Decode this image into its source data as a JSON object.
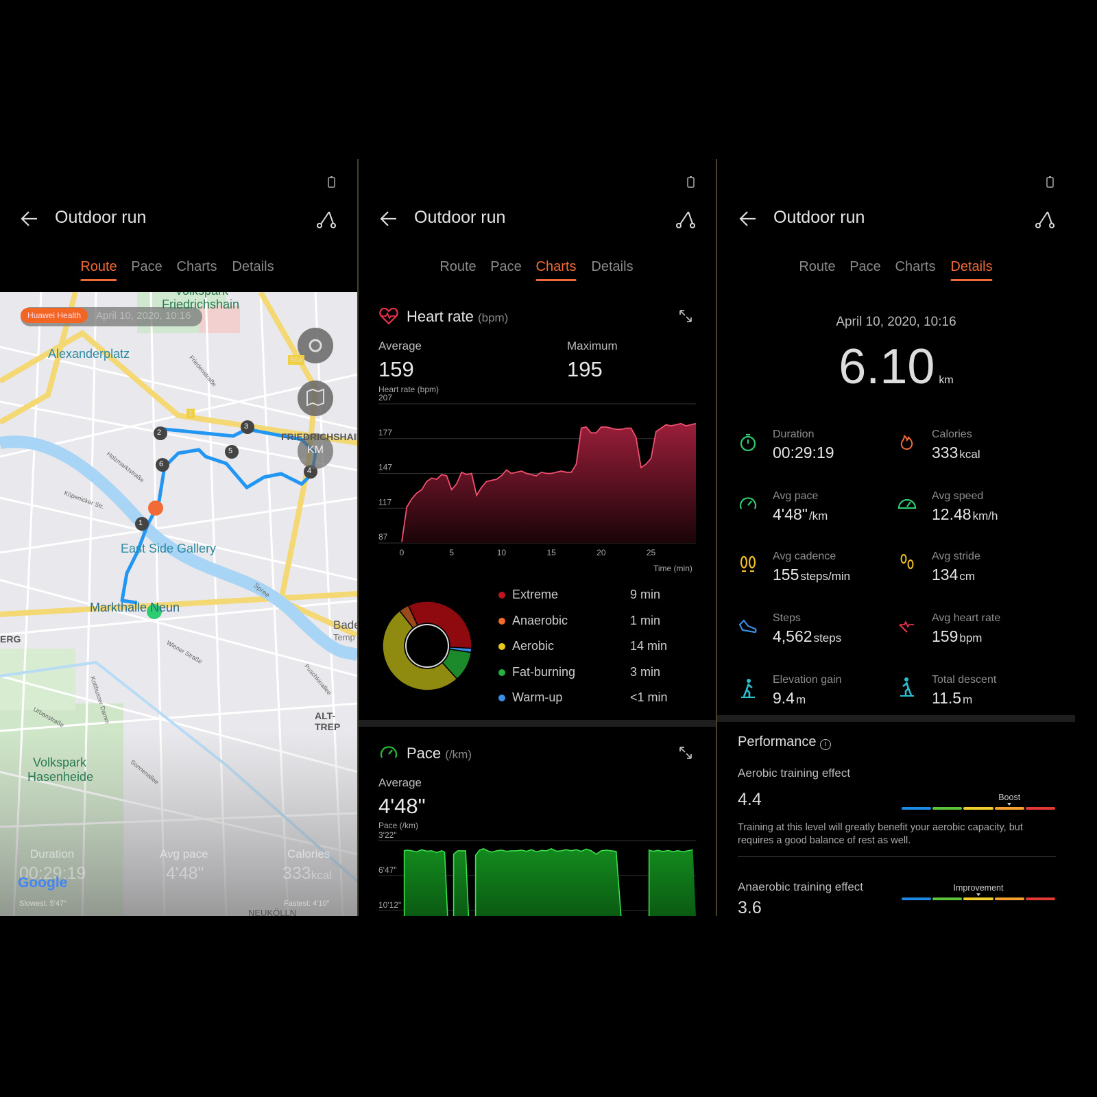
{
  "app_title": "Outdoor run",
  "tabs": [
    "Route",
    "Pace",
    "Charts",
    "Details"
  ],
  "active_tabs": {
    "panel1": "Route",
    "panel2": "Charts",
    "panel3": "Details"
  },
  "colors": {
    "accent": "#f26b36",
    "heart": "#e8334a",
    "pace": "#26c13a",
    "route": "#2196f3"
  },
  "map": {
    "badge": "Huawei Health",
    "date": "April 10, 2020, 10:16",
    "labels": {
      "park1_a": "Volkspark",
      "park1_b": "Friedrichshain",
      "alex": "Alexanderplatz",
      "friedrichshain": "FRIEDRICHSHAIN",
      "gallery": "East Side Gallery",
      "markthalle": "Markthalle Neun",
      "bade": "Bade",
      "temp": "Temp",
      "erg": "ERG",
      "alt": "ALT-TREP",
      "park2_a": "Volkspark",
      "park2_b": "Hasenheide",
      "neukoelln": "NEUKÖLLN",
      "road96": "96a",
      "road1": "1",
      "km": "KM",
      "spree": "Spree",
      "holz": "Holzmarktstraße",
      "kopen": "Köpenicker Str.",
      "wiener": "Wiener Straße",
      "kott": "Kottbusser Damm",
      "urban": "Urbanstraße",
      "sonnen": "Sonnenallee",
      "puschkin": "Puschkinallee",
      "friedenstr": "Friedenstraße"
    },
    "markers": [
      "1",
      "2",
      "3",
      "4",
      "5",
      "6"
    ],
    "stats": {
      "duration_label": "Duration",
      "duration": "00:29:19",
      "pace_label": "Avg pace",
      "pace": "4'48\"",
      "calories_label": "Calories",
      "calories": "333",
      "calories_unit": "kcal",
      "slowest": "Slowest: 5'47\"",
      "fastest": "Fastest: 4'10\""
    },
    "google": "Google"
  },
  "heart": {
    "title": "Heart rate",
    "unit": "(bpm)",
    "avg_label": "Average",
    "avg": "159",
    "max_label": "Maximum",
    "max": "195",
    "zones": [
      {
        "name": "Extreme",
        "value": "9 min",
        "minutes": 9,
        "color": "#c0141c",
        "ring": "#8e0a0f"
      },
      {
        "name": "Anaerobic",
        "value": "1 min",
        "minutes": 1,
        "color": "#f06a2a",
        "ring": "#9b4a1c"
      },
      {
        "name": "Aerobic",
        "value": "14 min",
        "minutes": 14,
        "color": "#e8c81e",
        "ring": "#8f8a10"
      },
      {
        "name": "Fat-burning",
        "value": "3 min",
        "minutes": 3,
        "color": "#22b040",
        "ring": "#1c8a2a"
      },
      {
        "name": "Warm-up",
        "value": "<1 min",
        "minutes": 0.4,
        "color": "#3a8ee6",
        "ring": "#3a8ee6"
      }
    ]
  },
  "pace": {
    "title": "Pace",
    "unit": "(/km)",
    "avg_label": "Average",
    "avg": "4'48\""
  },
  "chart_data": [
    {
      "type": "area",
      "ylabel": "Heart rate (bpm)",
      "xlabel": "Time (min)",
      "yticks": [
        "207",
        "177",
        "147",
        "117",
        "87"
      ],
      "ylim": [
        87,
        207
      ],
      "xticks": [
        "0",
        "5",
        "10",
        "15",
        "20",
        "25"
      ],
      "xlim": [
        0,
        29.5
      ],
      "grid": true,
      "x": [
        0,
        0.5,
        1,
        1.5,
        2,
        2.5,
        3,
        3.5,
        4,
        4.5,
        5,
        5.5,
        6,
        6.5,
        7,
        7.5,
        8,
        8.5,
        9,
        9.5,
        10,
        10.5,
        11,
        11.5,
        12,
        12.5,
        13,
        13.5,
        14,
        14.5,
        15,
        15.5,
        16,
        16.5,
        17,
        17.5,
        18,
        18.5,
        19,
        19.5,
        20,
        20.5,
        21,
        21.5,
        22,
        22.5,
        23,
        23.5,
        24,
        24.5,
        25,
        25.5,
        26,
        26.5,
        27,
        27.5,
        28,
        28.5,
        29,
        29.5
      ],
      "values": [
        88,
        118,
        125,
        130,
        133,
        140,
        143,
        142,
        146,
        145,
        133,
        138,
        148,
        146,
        147,
        128,
        135,
        140,
        141,
        142,
        145,
        150,
        147,
        148,
        149,
        147,
        146,
        145,
        148,
        147,
        147,
        148,
        149,
        148,
        148,
        155,
        186,
        187,
        182,
        182,
        187,
        187,
        186,
        185,
        185,
        186,
        186,
        178,
        152,
        155,
        160,
        183,
        186,
        189,
        188,
        189,
        190,
        188,
        189,
        190
      ]
    },
    {
      "type": "area",
      "ylabel": "Pace (/km)",
      "yticks": [
        "3'22\"",
        "6'47\"",
        "10'12\""
      ],
      "ylim_seconds": [
        202,
        612
      ],
      "xlim": [
        0,
        29.5
      ],
      "grid": true,
      "x": [
        0,
        0.25,
        0.5,
        1,
        1.5,
        2,
        2.5,
        3,
        3.5,
        4,
        4.3,
        4.6,
        4.9,
        5.2,
        5.6,
        6,
        6.4,
        6.7,
        7.1,
        7.4,
        7.8,
        8.2,
        8.6,
        9,
        9.5,
        10,
        10.5,
        11,
        11.5,
        12,
        12.5,
        13,
        13.5,
        14,
        14.5,
        15,
        15.5,
        16,
        16.5,
        17,
        17.5,
        18,
        18.5,
        19,
        19.5,
        20,
        20.5,
        21,
        21.5,
        22,
        22.5,
        23,
        23.3,
        23.6,
        24,
        24.4,
        24.8,
        25.2,
        25.7,
        26.2,
        26.7,
        27.2,
        27.7,
        28.2,
        28.7,
        29.2
      ],
      "values_seconds": [
        null,
        262,
        258,
        262,
        268,
        256,
        264,
        262,
        272,
        262,
        270,
        null,
        null,
        282,
        262,
        262,
        262,
        null,
        null,
        288,
        258,
        250,
        262,
        270,
        262,
        258,
        265,
        262,
        262,
        258,
        265,
        255,
        268,
        260,
        262,
        250,
        264,
        262,
        255,
        262,
        255,
        265,
        252,
        262,
        282,
        262,
        258,
        262,
        265,
        null,
        null,
        null,
        null,
        null,
        null,
        null,
        null,
        null,
        null,
        null,
        null,
        null,
        null,
        null,
        null,
        null
      ],
      "values_note_free": []
    }
  ],
  "details": {
    "date": "April 10, 2020, 10:16",
    "distance": "6.10",
    "distance_unit": "km",
    "metrics": [
      {
        "label": "Duration",
        "value": "00:29:19",
        "unit": "",
        "icon": "stopwatch-icon",
        "color": "#2ecc71"
      },
      {
        "label": "Calories",
        "value": "333",
        "unit": "kcal",
        "icon": "flame-icon",
        "color": "#f06a3a"
      },
      {
        "label": "Avg pace",
        "value": "4'48\"",
        "unit": "/km",
        "icon": "pace-gauge-icon",
        "color": "#2ecc71"
      },
      {
        "label": "Avg speed",
        "value": "12.48",
        "unit": "km/h",
        "icon": "speedometer-icon",
        "color": "#2ecc71"
      },
      {
        "label": "Avg cadence",
        "value": "155",
        "unit": "steps/min",
        "icon": "footprints-icon",
        "color": "#f0c020"
      },
      {
        "label": "Avg stride",
        "value": "134",
        "unit": "cm",
        "icon": "stride-icon",
        "color": "#f0c020"
      },
      {
        "label": "Steps",
        "value": "4,562",
        "unit": "steps",
        "icon": "shoe-icon",
        "color": "#3a8ee6"
      },
      {
        "label": "Avg heart rate",
        "value": "159",
        "unit": "bpm",
        "icon": "heart-icon",
        "color": "#e8334a"
      },
      {
        "label": "Elevation gain",
        "value": "9.4",
        "unit": "m",
        "icon": "hiker-up-icon",
        "color": "#2bc0d0"
      },
      {
        "label": "Total descent",
        "value": "11.5",
        "unit": "m",
        "icon": "hiker-down-icon",
        "color": "#2bc0d0"
      }
    ],
    "performance": {
      "title": "Performance",
      "aerobic_label": "Aerobic training effect",
      "aerobic_value": "4.4",
      "aerobic_level": "Boost",
      "aerobic_level_fraction": 0.7,
      "aerobic_desc": "Training at this level will greatly benefit your aerobic capacity, but requires a good balance of rest as well.",
      "anaerobic_label": "Anaerobic training effect",
      "anaerobic_value": "3.6",
      "anaerobic_level": "Improvement",
      "anaerobic_level_fraction": 0.5,
      "scale_colors": [
        "#1e88e5",
        "#5cc43a",
        "#f0d030",
        "#f5a030",
        "#e53935"
      ]
    }
  }
}
